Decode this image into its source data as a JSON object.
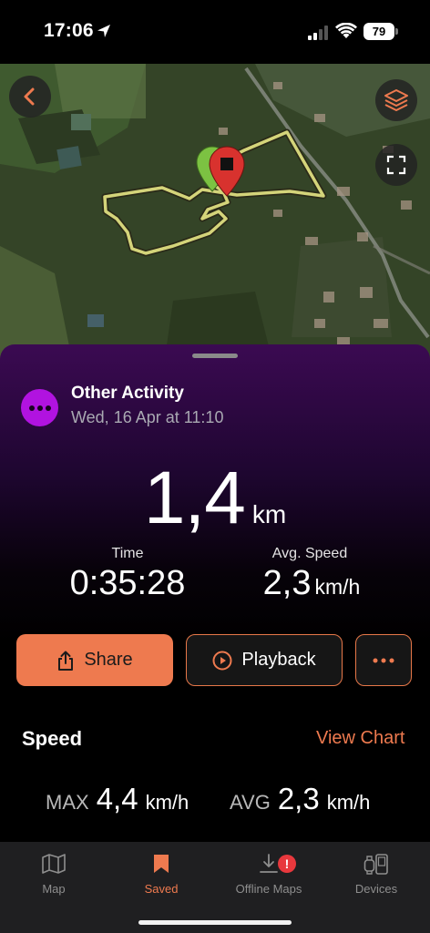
{
  "status": {
    "time": "17:06",
    "battery": "79"
  },
  "activity": {
    "title": "Other Activity",
    "date": "Wed, 16 Apr at 11:10"
  },
  "distance": {
    "value": "1,4",
    "unit": "km"
  },
  "stats": {
    "time_label": "Time",
    "time_value": "0:35:28",
    "speed_label": "Avg. Speed",
    "speed_value": "2,3",
    "speed_unit": "km/h"
  },
  "actions": {
    "share_label": "Share",
    "playback_label": "Playback",
    "more_label": "•••"
  },
  "speed_section": {
    "heading": "Speed",
    "view_chart_label": "View Chart",
    "max_tag": "MAX",
    "max_value": "4,4",
    "max_unit": "km/h",
    "avg_tag": "AVG",
    "avg_value": "2,3",
    "avg_unit": "km/h"
  },
  "tabs": [
    {
      "label": "Map",
      "icon": "map-icon"
    },
    {
      "label": "Saved",
      "icon": "bookmark-icon"
    },
    {
      "label": "Offline Maps",
      "icon": "download-icon",
      "badge": "!"
    },
    {
      "label": "Devices",
      "icon": "devices-icon"
    }
  ],
  "colors": {
    "accent": "#ee7a4f",
    "activity": "#b113e0",
    "route": "#d4d47a",
    "start_pin": "#7cc242",
    "end_pin": "#d8322e"
  }
}
